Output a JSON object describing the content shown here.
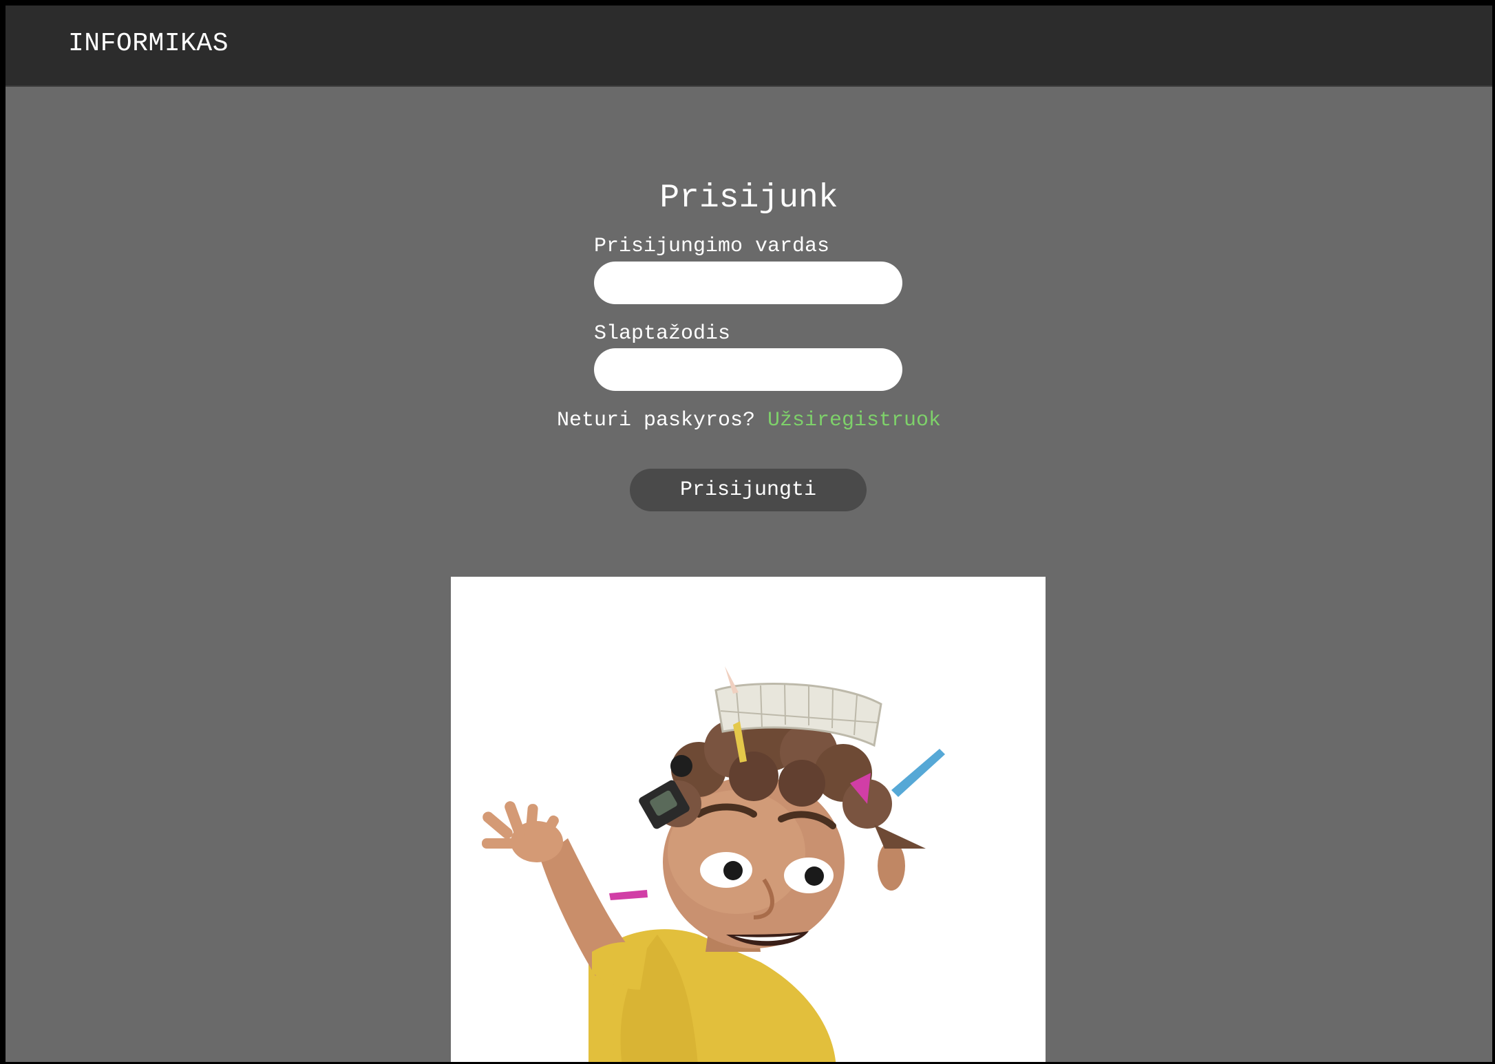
{
  "navbar": {
    "brand": "INFORMIKAS"
  },
  "login": {
    "title": "Prisijunk",
    "username_label": "Prisijungimo vardas",
    "username_value": "",
    "password_label": "Slaptažodis",
    "password_value": "",
    "register_prompt": "Neturi paskyros?",
    "register_link": "Užsiregistruok",
    "submit_label": "Prisijungti"
  },
  "illustration": {
    "subject": "cartoon-boy-mascot"
  },
  "colors": {
    "navbar_bg": "#2c2c2c",
    "page_bg": "#6a6a6a",
    "link": "#7ed16a",
    "button_bg": "#4a4a4a",
    "input_bg": "#ffffff"
  }
}
